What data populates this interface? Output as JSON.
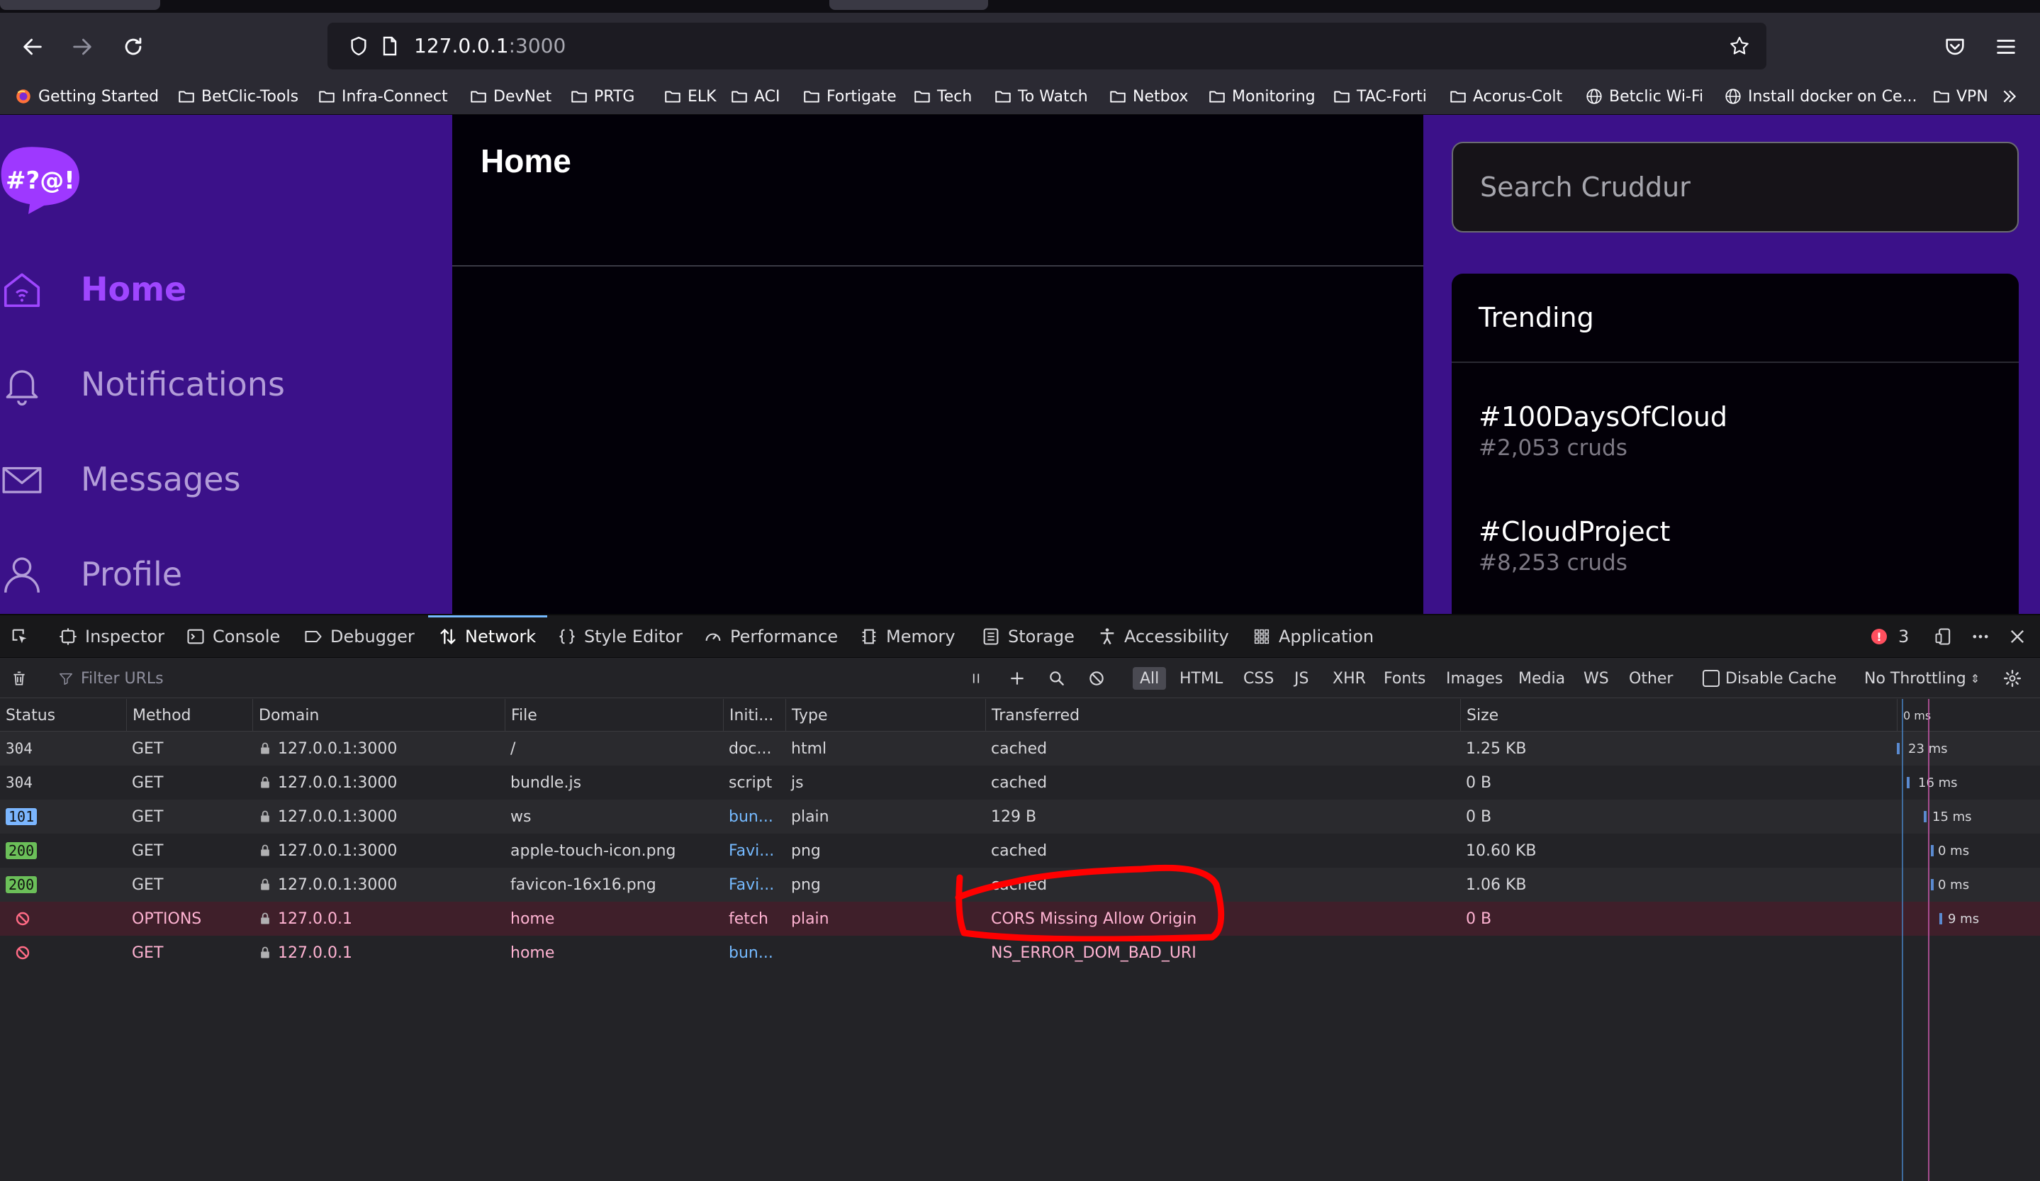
{
  "browser": {
    "url_host": "127.0.0.1",
    "url_port": ":3000",
    "bookmarks": [
      {
        "label": "Getting Started",
        "icon": "firefox-icon"
      },
      {
        "label": "BetClic-Tools",
        "icon": "folder-icon"
      },
      {
        "label": "Infra-Connect",
        "icon": "folder-icon"
      },
      {
        "label": "DevNet",
        "icon": "folder-icon"
      },
      {
        "label": "PRTG",
        "icon": "folder-icon"
      },
      {
        "label": "ELK",
        "icon": "folder-icon"
      },
      {
        "label": "ACI",
        "icon": "folder-icon"
      },
      {
        "label": "Fortigate",
        "icon": "folder-icon"
      },
      {
        "label": "Tech",
        "icon": "folder-icon"
      },
      {
        "label": "To Watch",
        "icon": "folder-icon"
      },
      {
        "label": "Netbox",
        "icon": "folder-icon"
      },
      {
        "label": "Monitoring",
        "icon": "folder-icon"
      },
      {
        "label": "TAC-Forti",
        "icon": "folder-icon"
      },
      {
        "label": "Acorus-Colt",
        "icon": "folder-icon"
      },
      {
        "label": "Betclic Wi-Fi",
        "icon": "globe-icon"
      },
      {
        "label": "Install docker on Ce...",
        "icon": "globe-icon"
      },
      {
        "label": "VPN",
        "icon": "folder-icon"
      }
    ]
  },
  "app": {
    "logo_text": "#?@!",
    "nav": [
      {
        "label": "Home",
        "icon": "home-icon",
        "active": true
      },
      {
        "label": "Notifications",
        "icon": "bell-icon",
        "active": false
      },
      {
        "label": "Messages",
        "icon": "envelope-icon",
        "active": false
      },
      {
        "label": "Profile",
        "icon": "user-icon",
        "active": false
      }
    ],
    "page_title": "Home",
    "search_placeholder": "Search Cruddur",
    "trending": {
      "title": "Trending",
      "items": [
        {
          "tag": "#100DaysOfCloud",
          "count": "#2,053 cruds"
        },
        {
          "tag": "#CloudProject",
          "count": "#8,253 cruds"
        }
      ]
    }
  },
  "devtools": {
    "tabs": [
      "Inspector",
      "Console",
      "Debugger",
      "Network",
      "Style Editor",
      "Performance",
      "Memory",
      "Storage",
      "Accessibility",
      "Application"
    ],
    "active_tab": "Network",
    "error_count": "3",
    "filter_placeholder": "Filter URLs",
    "type_filters": [
      "All",
      "HTML",
      "CSS",
      "JS",
      "XHR",
      "Fonts",
      "Images",
      "Media",
      "WS",
      "Other"
    ],
    "disable_cache_label": "Disable Cache",
    "throttling_label": "No Throttling",
    "columns": [
      "Status",
      "Method",
      "Domain",
      "File",
      "Initi...",
      "Type",
      "Transferred",
      "Size",
      "0 ms"
    ],
    "requests": [
      {
        "status": "304",
        "method": "GET",
        "domain": "127.0.0.1:3000",
        "file": "/",
        "initiator": "doc...",
        "type": "html",
        "transferred": "cached",
        "size": "1.25 KB",
        "timing": "23 ms"
      },
      {
        "status": "304",
        "method": "GET",
        "domain": "127.0.0.1:3000",
        "file": "bundle.js",
        "initiator": "script",
        "type": "js",
        "transferred": "cached",
        "size": "0 B",
        "timing": "16 ms"
      },
      {
        "status": "101",
        "method": "GET",
        "domain": "127.0.0.1:3000",
        "file": "ws",
        "initiator": "bun...",
        "type": "plain",
        "transferred": "129 B",
        "size": "0 B",
        "timing": "15 ms"
      },
      {
        "status": "200",
        "method": "GET",
        "domain": "127.0.0.1:3000",
        "file": "apple-touch-icon.png",
        "initiator": "Favi...",
        "type": "png",
        "transferred": "cached",
        "size": "10.60 KB",
        "timing": "0 ms"
      },
      {
        "status": "200",
        "method": "GET",
        "domain": "127.0.0.1:3000",
        "file": "favicon-16x16.png",
        "initiator": "Favi...",
        "type": "png",
        "transferred": "cached",
        "size": "1.06 KB",
        "timing": "0 ms"
      },
      {
        "status": "",
        "method": "OPTIONS",
        "domain": "127.0.0.1",
        "file": "home",
        "initiator": "fetch",
        "type": "plain",
        "transferred": "CORS Missing Allow Origin",
        "size": "0 B",
        "timing": "9 ms"
      },
      {
        "status": "",
        "method": "GET",
        "domain": "127.0.0.1",
        "file": "home",
        "initiator": "bun...",
        "type": "",
        "transferred": "NS_ERROR_DOM_BAD_URI",
        "size": "",
        "timing": ""
      }
    ]
  }
}
